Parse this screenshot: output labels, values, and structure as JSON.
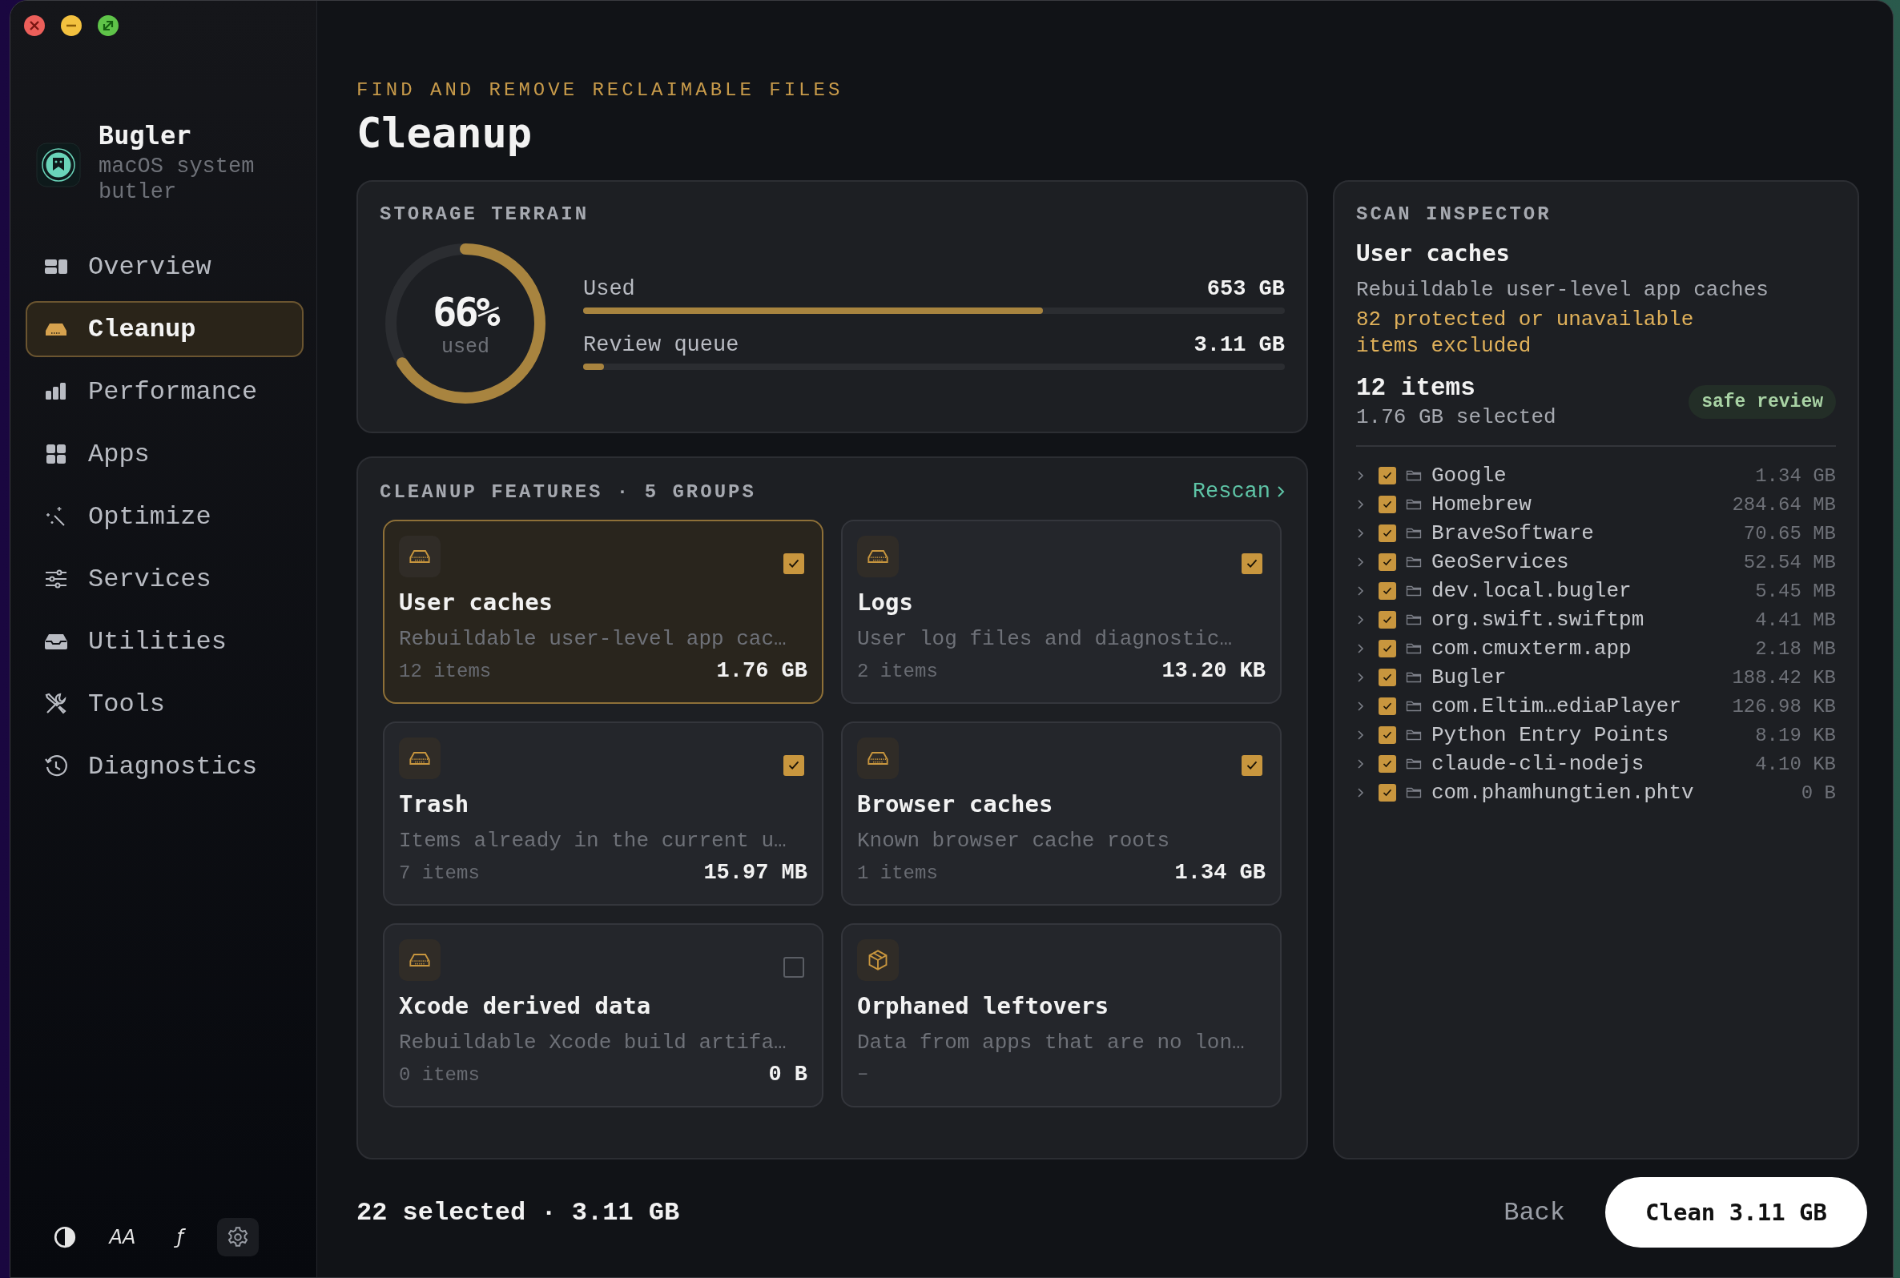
{
  "sidebar": {
    "app_name": "Bugler",
    "app_subtitle": "macOS system butler",
    "items": [
      {
        "label": "Overview",
        "kind": "overview",
        "selected": false
      },
      {
        "label": "Cleanup",
        "kind": "drive",
        "selected": true
      },
      {
        "label": "Performance",
        "kind": "bars",
        "selected": false
      },
      {
        "label": "Apps",
        "kind": "grid",
        "selected": false
      },
      {
        "label": "Optimize",
        "kind": "wand",
        "selected": false
      },
      {
        "label": "Services",
        "kind": "sliders",
        "selected": false
      },
      {
        "label": "Utilities",
        "kind": "tray",
        "selected": false
      },
      {
        "label": "Tools",
        "kind": "tools",
        "selected": false
      },
      {
        "label": "Diagnostics",
        "kind": "history",
        "selected": false
      }
    ],
    "footer_tools": [
      {
        "kind": "contrast",
        "selected": false
      },
      {
        "kind": "text",
        "glyph": "AA",
        "selected": false
      },
      {
        "kind": "text",
        "glyph": "ƒ",
        "selected": false
      },
      {
        "kind": "gear",
        "selected": true
      }
    ]
  },
  "header": {
    "eyebrow": "FIND AND REMOVE RECLAIMABLE FILES",
    "title": "Cleanup"
  },
  "storage": {
    "title": "STORAGE TERRAIN",
    "gauge": {
      "value": "66%",
      "caption": "used",
      "level": 0.66
    },
    "bars": [
      {
        "label": "Used",
        "reading": "653 GB",
        "level": 0.655
      },
      {
        "label": "Review queue",
        "reading": "3.11 GB",
        "level": 0.03
      }
    ]
  },
  "features": {
    "title": "CLEANUP FEATURES · 5 GROUPS",
    "rescan": "Rescan",
    "cards": [
      {
        "kind": "drive",
        "title": "User caches",
        "description": "Rebuildable user-level app cac…",
        "count": "12 items",
        "size": "1.76 GB",
        "checked": true,
        "selected": true
      },
      {
        "kind": "drive",
        "title": "Logs",
        "description": "User log files and diagnostic…",
        "count": "2 items",
        "size": "13.20 KB",
        "checked": true,
        "selected": false
      },
      {
        "kind": "drive",
        "title": "Trash",
        "description": "Items already in the current u…",
        "count": "7 items",
        "size": "15.97 MB",
        "checked": true,
        "selected": false
      },
      {
        "kind": "drive",
        "title": "Browser caches",
        "description": "Known browser cache roots",
        "count": "1 items",
        "size": "1.34 GB",
        "checked": true,
        "selected": false
      },
      {
        "kind": "drive",
        "title": "Xcode derived data",
        "description": "Rebuildable Xcode build artifa…",
        "count": "0 items",
        "size": "0 B",
        "checked": false,
        "selected": false
      },
      {
        "kind": "box",
        "title": "Orphaned leftovers",
        "description": "Data from apps that are no lon…",
        "count": "–",
        "selected": false
      }
    ]
  },
  "inspector": {
    "title": "SCAN INSPECTOR",
    "name": "User caches",
    "description": "Rebuildable user-level app caches",
    "warning": "82 protected or unavailable items excluded",
    "count": "12 items",
    "selected_size": "1.76 GB selected",
    "badge": "safe review",
    "items": [
      {
        "name": "Google",
        "size": "1.34 GB",
        "checked": true,
        "expanded": false
      },
      {
        "name": "Homebrew",
        "size": "284.64 MB",
        "checked": true,
        "expanded": false
      },
      {
        "name": "BraveSoftware",
        "size": "70.65 MB",
        "checked": true,
        "expanded": false
      },
      {
        "name": "GeoServices",
        "size": "52.54 MB",
        "checked": true,
        "expanded": false
      },
      {
        "name": "dev.local.bugler",
        "size": "5.45 MB",
        "checked": true,
        "expanded": false
      },
      {
        "name": "org.swift.swiftpm",
        "size": "4.41 MB",
        "checked": true,
        "expanded": false
      },
      {
        "name": "com.cmuxterm.app",
        "size": "2.18 MB",
        "checked": true,
        "expanded": false
      },
      {
        "name": "Bugler",
        "size": "188.42 KB",
        "checked": true,
        "expanded": false
      },
      {
        "name": "com.Eltim…ediaPlayer",
        "size": "126.98 KB",
        "checked": true,
        "expanded": false
      },
      {
        "name": "Python Entry Points",
        "size": "8.19 KB",
        "checked": true,
        "expanded": false
      },
      {
        "name": "claude-cli-nodejs",
        "size": "4.10 KB",
        "checked": true,
        "expanded": false
      },
      {
        "name": "com.phamhungtien.phtv",
        "size": "0 B",
        "checked": true,
        "expanded": false
      }
    ]
  },
  "footer": {
    "summary": "22 selected · 3.11 GB",
    "back": "Back",
    "primary": "Clean 3.11 GB"
  }
}
